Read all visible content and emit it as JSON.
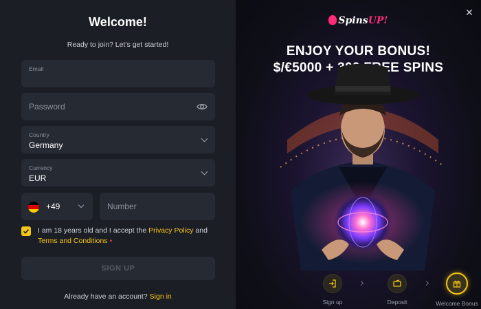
{
  "form": {
    "title": "Welcome!",
    "subtitle": "Ready to join? Let’s get started!",
    "email": {
      "label": "Email",
      "value": ""
    },
    "password": {
      "placeholder": "Password"
    },
    "country": {
      "label": "Country",
      "value": "Germany"
    },
    "currency": {
      "label": "Currency",
      "value": "EUR"
    },
    "phone": {
      "code": "+49",
      "placeholder": "Number"
    },
    "consent": {
      "checked": true,
      "text_before": "I am 18 years old and I accept the ",
      "privacy_link": "Privacy Policy",
      "text_and": " and",
      "terms_link": "Terms and Conditions",
      "required_mark": "•"
    },
    "signup_button": "SIGN UP",
    "already_text": "Already have an account?",
    "signin_link": "Sign in"
  },
  "promo": {
    "logo_text": "Spins",
    "logo_accent": "UP!",
    "headline_line1": "ENJOY YOUR BONUS!",
    "headline_line2": "$/€5000 + 300 FREE SPINS",
    "steps": [
      {
        "label": "Sign up",
        "icon": "login-icon",
        "active": false
      },
      {
        "label": "Deposit",
        "icon": "wallet-icon",
        "active": false
      },
      {
        "label": "Welcome Bonus",
        "icon": "gift-icon",
        "active": true
      }
    ]
  },
  "close_icon": "close-icon",
  "colors": {
    "accent": "#f5c518",
    "brand": "#ff2a78",
    "field_bg": "#262a33",
    "panel_bg": "#1b1e24"
  }
}
